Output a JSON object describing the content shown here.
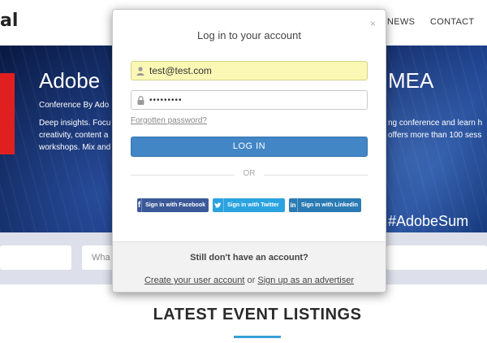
{
  "site": {
    "logo_text": "al",
    "nav": [
      "NEWS",
      "CONTACT"
    ],
    "hero": {
      "title_left": "Adobe",
      "title_right": "MEA",
      "subtitle": "Conference By Ado",
      "text_left_1": "Deep insights. Focu",
      "text_left_2": "creativity, content a",
      "text_left_3": "workshops. Mix and",
      "text_right_1": "ng conference and learn h",
      "text_right_2": "offers more than 100 sess",
      "hashtag": "#AdobeSum"
    },
    "search": {
      "partial_placeholder": "Wha"
    },
    "section_title": "LATEST EVENT LISTINGS"
  },
  "modal": {
    "title": "Log in to your account",
    "close": "×",
    "email_value": "test@test.com",
    "password_value": "•••••••••",
    "forgot_link": "Forgotten password?",
    "login_button": "LOG IN",
    "or_text": "OR",
    "social": {
      "facebook": "Sign in with Facebook",
      "twitter": "Sign in with Twitter",
      "linkedin": "Sign in with Linkedin"
    },
    "footer": {
      "question": "Still don't have an account?",
      "create_account": "Create your user account",
      "or_word": "or",
      "advertiser": "Sign up as an advertiser"
    }
  },
  "colors": {
    "primary": "#4386c6",
    "autofill": "#faf8b4",
    "facebook": "#3b5998",
    "twitter": "#2aa3e0",
    "linkedin": "#2a7bb3",
    "accent": "#3aa0d8"
  }
}
